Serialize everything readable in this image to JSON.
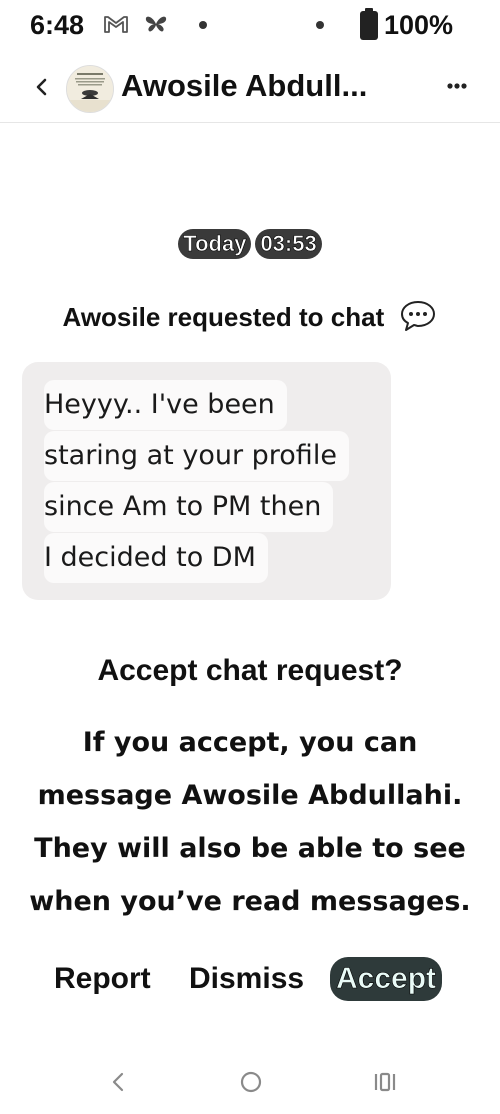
{
  "status_bar": {
    "time": "6:48",
    "battery_percent": "100%",
    "icons": [
      "gmail-icon",
      "butterfly-icon",
      "notification-dot",
      "notification-dot",
      "battery-icon"
    ]
  },
  "header": {
    "contact_name": "Awosile Abdull...",
    "back_icon": "chevron-left-icon",
    "more_icon": "more-horizontal-icon"
  },
  "conversation": {
    "date_label": "Today",
    "time_label": "03:53",
    "request_text": "Awosile requested to chat",
    "request_icon": "chat-bubble-icon",
    "message_lines": [
      "Heyyy.. I've been",
      "staring at your profile",
      "since Am to PM then",
      "I decided to DM"
    ]
  },
  "accept_prompt": {
    "title": "Accept chat request?",
    "body_lines": [
      "If you accept, you can",
      "message Awosile Abdullahi.",
      "They will also be able to see",
      "when you’ve read messages."
    ]
  },
  "actions": {
    "report": "Report",
    "dismiss": "Dismiss",
    "accept": "Accept"
  },
  "navigation": {
    "back_icon": "nav-back-icon",
    "home_icon": "nav-home-icon",
    "recents_icon": "nav-recents-icon"
  },
  "colors": {
    "background": "#ffffff",
    "bubble": "#efeded",
    "chip": "#3a3a3a",
    "accept_highlight": "#2e3a3a",
    "text": "#111111"
  }
}
